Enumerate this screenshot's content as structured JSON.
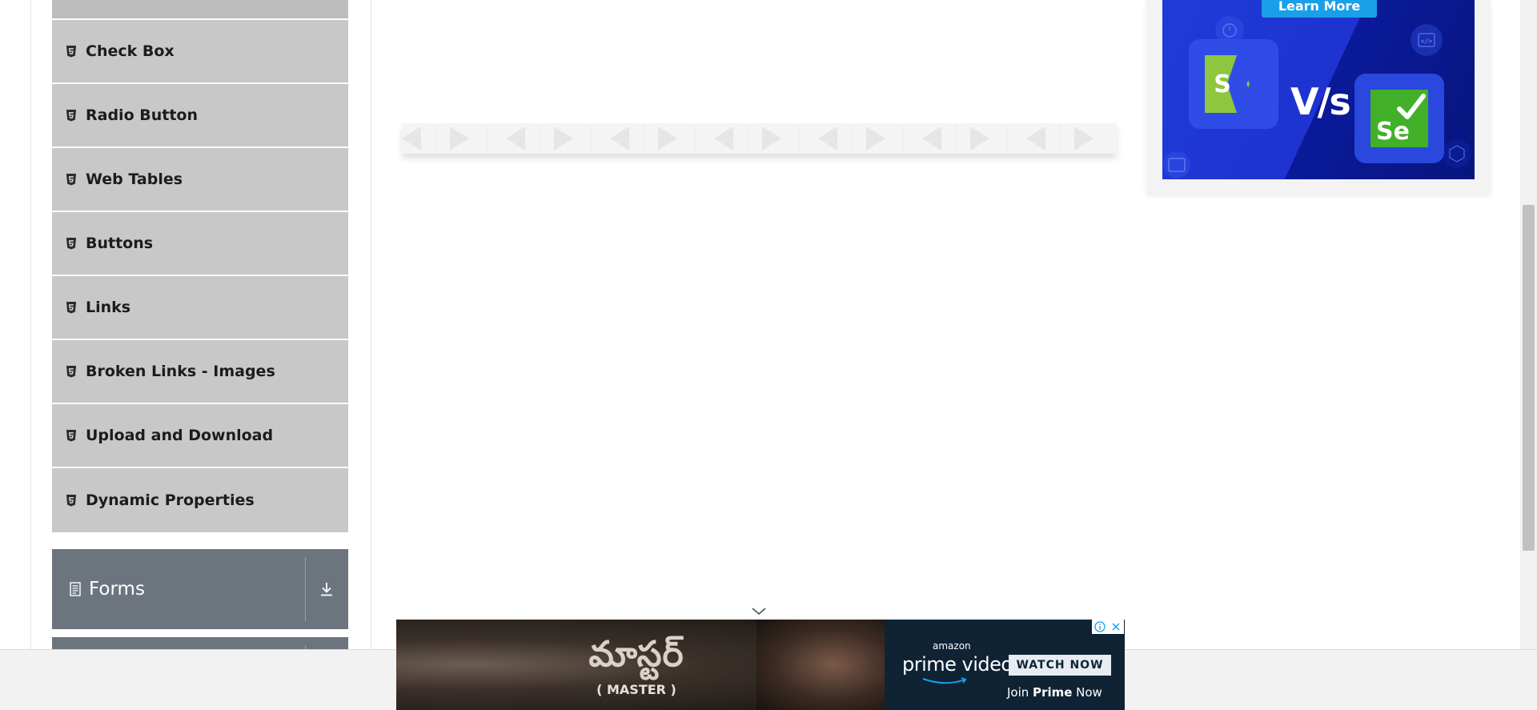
{
  "sidebar": {
    "elements_items": [
      {
        "label": "Check Box",
        "icon": "html5-icon"
      },
      {
        "label": "Radio Button",
        "icon": "html5-icon"
      },
      {
        "label": "Web Tables",
        "icon": "html5-icon"
      },
      {
        "label": "Buttons",
        "icon": "html5-icon"
      },
      {
        "label": "Links",
        "icon": "html5-icon"
      },
      {
        "label": "Broken Links - Images",
        "icon": "html5-icon"
      },
      {
        "label": "Upload and Download",
        "icon": "html5-icon"
      },
      {
        "label": "Dynamic Properties",
        "icon": "html5-icon"
      }
    ],
    "groups": [
      {
        "label": "Forms",
        "icon": "document-icon",
        "toggle_icon": "download-arrow-icon"
      }
    ]
  },
  "right_ad": {
    "button_label": "Learn More",
    "vs_text": "V/s",
    "left_logo_letter": "S",
    "right_logo_text": "Se"
  },
  "bottom_ad": {
    "movie_title": "మాస్టర్",
    "movie_subtitle": "( MASTER )",
    "brand_small": "amazon",
    "brand_main": "prime video",
    "cta_label": "WATCH NOW",
    "tagline_prefix": "Join ",
    "tagline_bold": "Prime",
    "tagline_suffix": " Now"
  },
  "colors": {
    "menu_item_bg": "#c8c8c8",
    "group_header_bg": "#6c757d",
    "ad_blue": "#1f3bd8",
    "learn_more_blue": "#1aa0e8",
    "prime_navy": "#0f2335"
  }
}
